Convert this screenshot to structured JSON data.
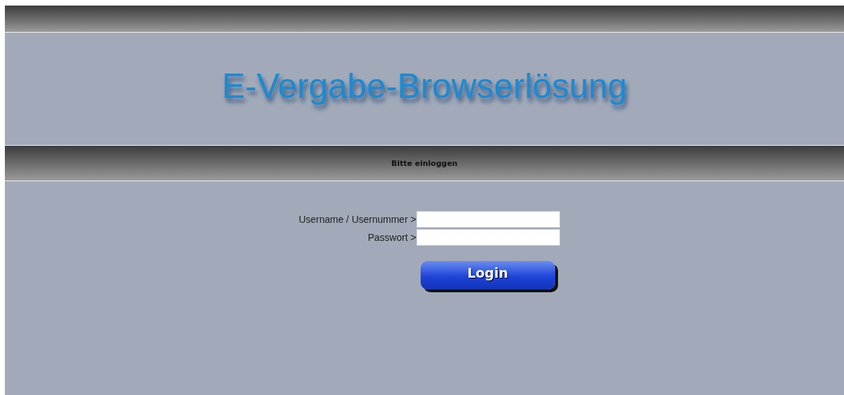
{
  "header": {
    "title": "E-Vergabe-Browserlösung"
  },
  "login_bar": {
    "title": "Bitte einloggen"
  },
  "form": {
    "fields": [
      {
        "label": "Username / Usernummer >"
      },
      {
        "label": "Passwort >"
      }
    ],
    "submit": "Login"
  }
}
